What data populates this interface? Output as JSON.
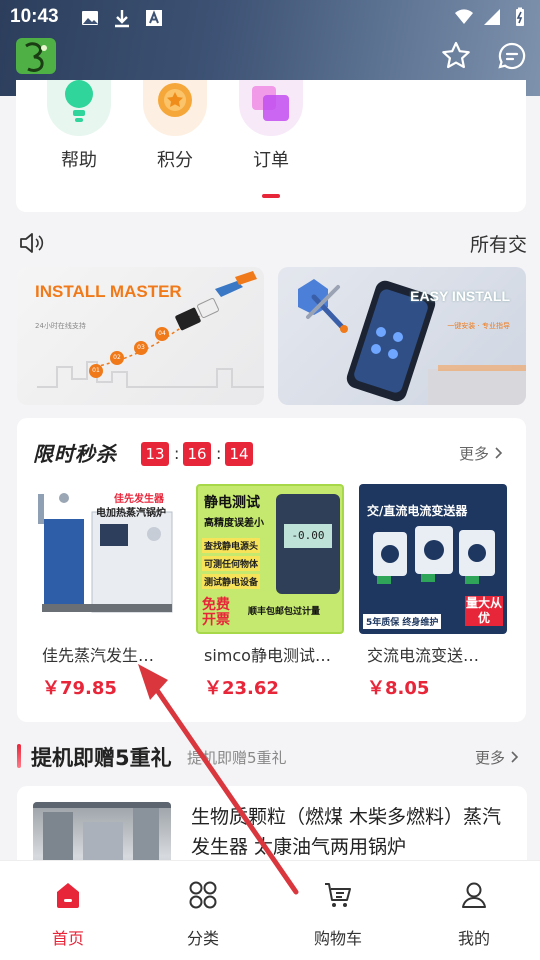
{
  "status_bar": {
    "time": "10:43"
  },
  "quick_links": [
    {
      "label": "帮助",
      "icon": "lightbulb-icon",
      "color": "#e7f6ef"
    },
    {
      "label": "积分",
      "icon": "coin-icon",
      "color": "#fdf0e2"
    },
    {
      "label": "订单",
      "icon": "order-icon",
      "color": "#f7e9f8"
    }
  ],
  "notice": {
    "text": "所有交"
  },
  "banners": {
    "left": {
      "title": "INSTALL MASTER",
      "subtitle": "24小时在线支持",
      "steps": [
        "01",
        "02",
        "03",
        "04"
      ]
    },
    "right": {
      "title": "EASY INSTALL",
      "subtitle": "一键安装 · 专业指导"
    }
  },
  "flash_sale": {
    "title": "限时秒杀",
    "timer": {
      "h": "13",
      "m": "16",
      "s": "14"
    },
    "more": "更多",
    "products": [
      {
        "name": "佳先蒸汽发生…",
        "price": "￥79.85",
        "img_text": [
          "佳先发生器",
          "电加热蒸汽锅炉"
        ]
      },
      {
        "name": "simco静电测试…",
        "price": "￥23.62",
        "img_text": [
          "静电测试",
          "高精度误差小",
          "查找静电源头",
          "可测任何物体",
          "测试静电设备",
          "免费开票",
          "顺丰包邮包过计量"
        ],
        "display": "-0.00"
      },
      {
        "name": "交流电流变送…",
        "price": "￥8.05",
        "img_text": [
          "交/直流电流变送器",
          "5年质保 终身维护",
          "量大从优"
        ]
      }
    ]
  },
  "gift_section": {
    "title": "提机即赠5重礼",
    "subtitle": "提机即赠5重礼",
    "more": "更多",
    "item_text": "生物质颗粒（燃煤 木柴多燃料）蒸汽发生器 太康油气两用锅炉"
  },
  "bottom_nav": [
    {
      "label": "首页",
      "icon": "home-icon",
      "active": true
    },
    {
      "label": "分类",
      "icon": "grid-icon",
      "active": false
    },
    {
      "label": "购物车",
      "icon": "cart-icon",
      "active": false
    },
    {
      "label": "我的",
      "icon": "user-icon",
      "active": false
    }
  ],
  "colors": {
    "accent": "#e8263a",
    "header": "#3d5274"
  }
}
